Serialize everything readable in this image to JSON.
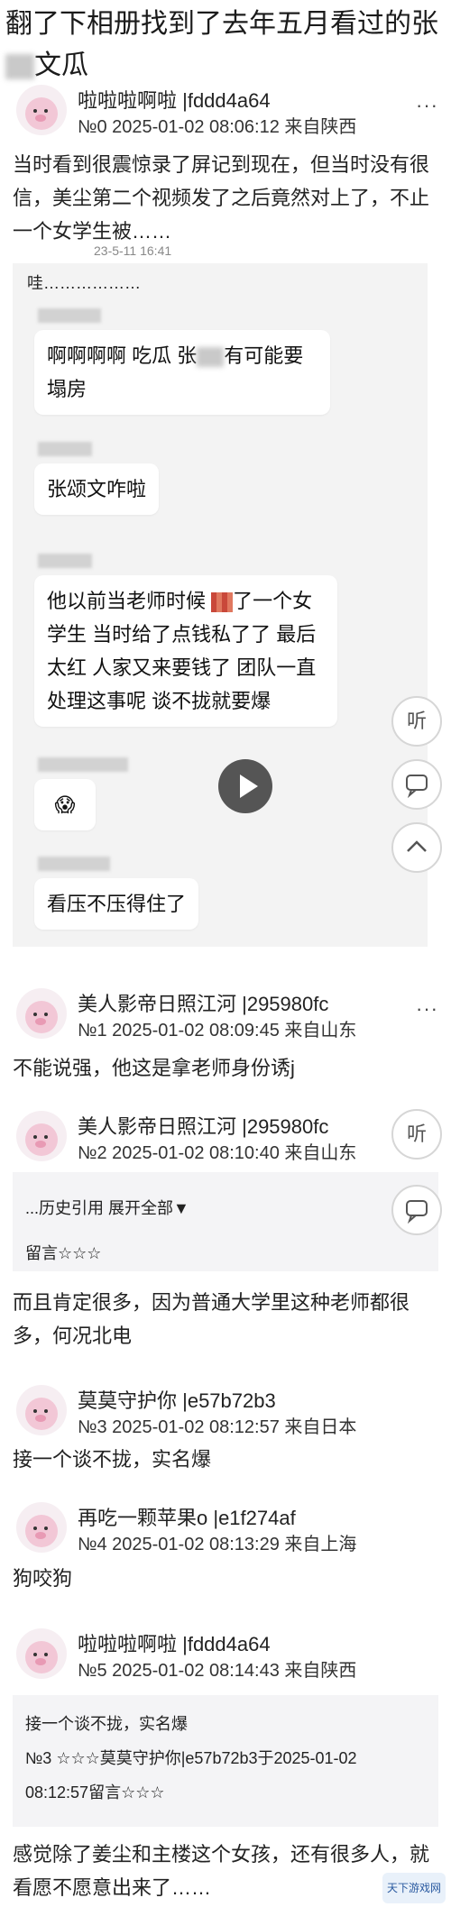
{
  "title": {
    "before": "翻了下相册找到了去年五月看过的张",
    "after": "文瓜"
  },
  "posts": [
    {
      "user": "啦啦啦啊啦 |fddd4a64",
      "meta": "№0 2025-01-02 08:06:12 来自陕西",
      "text": "当时看到很震惊录了屏记到现在，但当时没有很信，美尘第二个视频发了之后竟然对上了，不止一个女学生被……"
    },
    {
      "user": "美人影帝日照江河 |295980fc",
      "meta": "№1 2025-01-02 08:09:45 来自山东",
      "text": "不能说强，他这是拿老师身份诱j"
    },
    {
      "user": "美人影帝日照江河 |295980fc",
      "meta": "№2 2025-01-02 08:10:40 来自山东",
      "text": "而且肯定很多，因为普通大学里这种老师都很多，何况北电"
    },
    {
      "user": "莫莫守护你 |e57b72b3",
      "meta": "№3 2025-01-02 08:12:57 来自日本",
      "text": "接一个谈不拢，实名爆"
    },
    {
      "user": "再吃一颗苹果o |e1f274af",
      "meta": "№4 2025-01-02 08:13:29 来自上海",
      "text": "狗咬狗"
    },
    {
      "user": "啦啦啦啊啦 |fddd4a64",
      "meta": "№5 2025-01-02 08:14:43 来自陕西",
      "text": "感觉除了姜尘和主楼这个女孩，还有很多人，就看愿不愿意出来了……"
    }
  ],
  "screenshot": {
    "time": "23-5-11 16:41",
    "first_line": "哇………………",
    "b1_pre": "啊啊啊啊 吃瓜 张",
    "b1_post": "有可能要塌房",
    "b2": "张颂文咋啦",
    "b3_pre": "他以前当老师时候",
    "b3_post": "了一个女学生 当时给了点钱私了了 最后太红 人家又来要钱了 团队一直处理这事呢 谈不拢就要爆",
    "emoji": "😱",
    "b5": "看压不压得住了"
  },
  "quote1": {
    "line1": "...历史引用 展开全部▼",
    "line2": "留言☆☆☆"
  },
  "quote2": {
    "line1": "接一个谈不拢，实名爆",
    "line2": "№3 ☆☆☆莫莫守护你|e57b72b3于2025-01-02",
    "line3": "08:12:57留言☆☆☆"
  },
  "buttons": {
    "listen": "听",
    "more": "···"
  },
  "watermark": "天下游戏网"
}
